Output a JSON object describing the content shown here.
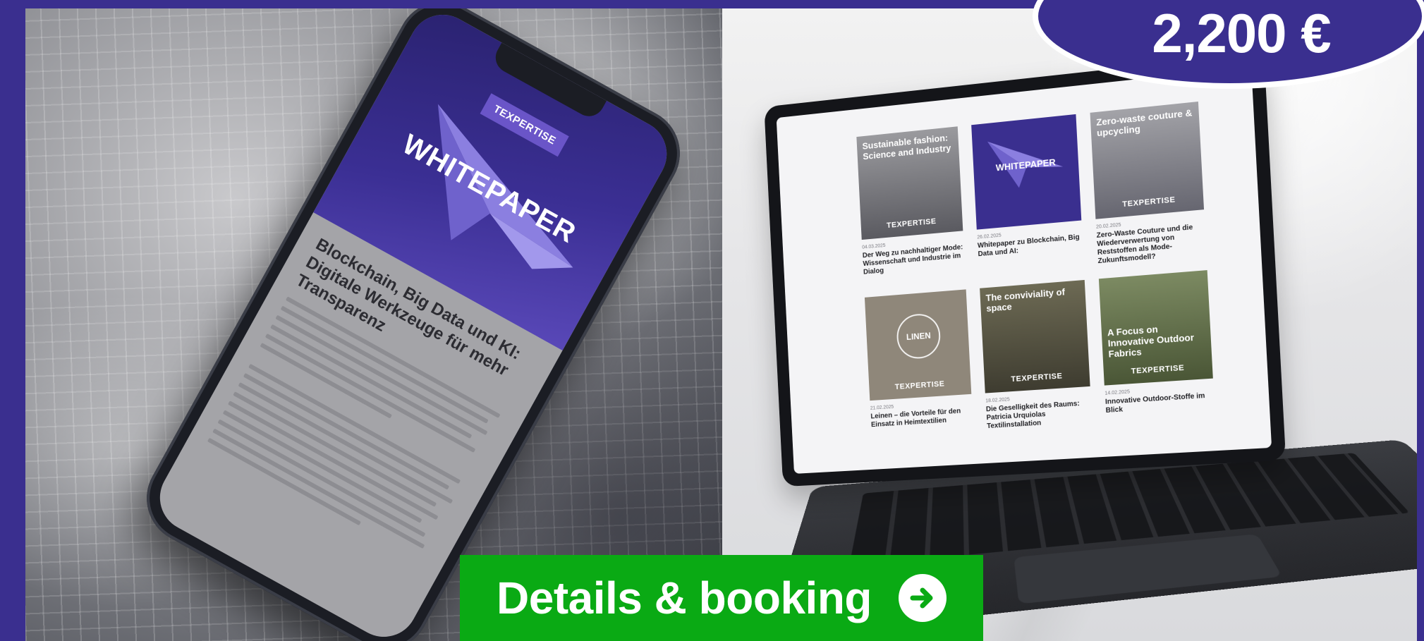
{
  "price": {
    "label": "2,200 €",
    "colors": {
      "bubble": "#3a2f8f",
      "border": "#ffffff",
      "text": "#ffffff"
    }
  },
  "cta": {
    "label": "Details & booking",
    "icon": "arrow-right-circle-icon",
    "colors": {
      "background": "#0aaa14",
      "text": "#ffffff"
    }
  },
  "phone": {
    "badge": "TEXPERTISE",
    "hero_title": "WHITEPAPER",
    "headline": "Blockchain, Big Data und KI: Digitale Werkzeuge für mehr Transparenz"
  },
  "laptop": {
    "cards": [
      {
        "thumb_title": "Sustainable fashion: Science and Industry",
        "thumb_brand": "TEXPERTISE",
        "date": "04.03.2025",
        "title": "Der Weg zu nachhaltiger Mode: Wissenschaft und Industrie im Dialog"
      },
      {
        "thumb_title": "WHITEPAPER",
        "thumb_brand": "",
        "date": "26.02.2025",
        "title": "Whitepaper zu Blockchain, Big Data und AI:"
      },
      {
        "thumb_title": "Zero-waste couture & upcycling",
        "thumb_brand": "TEXPERTISE",
        "date": "20.02.2025",
        "title": "Zero-Waste Couture und die Wiederverwertung von Reststoffen als Mode-Zukunftsmodell?"
      },
      {
        "thumb_title": "LINEN",
        "thumb_brand": "TEXPERTISE",
        "date": "21.02.2025",
        "title": "Leinen – die Vorteile für den Einsatz in Heimtextilien"
      },
      {
        "thumb_title": "The conviviality of space",
        "thumb_brand": "TEXPERTISE",
        "date": "18.02.2025",
        "title": "Die Geselligkeit des Raums: Patricia Urquiolas Textilinstallation"
      },
      {
        "thumb_title": "A Focus on Innovative Outdoor Fabrics",
        "thumb_brand": "TEXPERTISE",
        "date": "14.02.2025",
        "title": "Innovative Outdoor-Stoffe im Blick"
      }
    ]
  },
  "colors": {
    "frame": "#3a2f8f",
    "accent_purple": "#5948b8"
  }
}
